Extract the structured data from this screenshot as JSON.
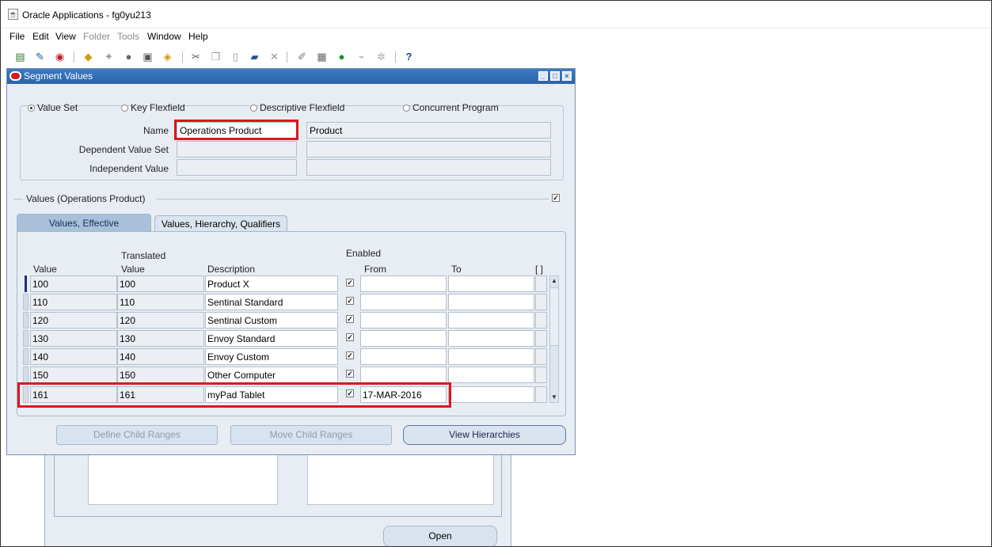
{
  "app": {
    "title": "Oracle Applications - fg0yu213"
  },
  "menu": [
    {
      "label": "File",
      "enabled": true
    },
    {
      "label": "Edit",
      "enabled": true
    },
    {
      "label": "View",
      "enabled": true
    },
    {
      "label": "Folder",
      "enabled": false
    },
    {
      "label": "Tools",
      "enabled": false
    },
    {
      "label": "Window",
      "enabled": true
    },
    {
      "label": "Help",
      "enabled": true
    }
  ],
  "toolbar_icons": [
    "new-icon",
    "find-icon",
    "navigator-icon",
    "save-icon",
    "next-step-icon",
    "switch-responsibility-icon",
    "print-icon",
    "close-form-icon",
    "cut-icon",
    "copy-icon",
    "paste-icon",
    "new-record-icon",
    "delete-record-icon",
    "edit-field-icon",
    "zoom-icon",
    "translations-icon",
    "attachments-icon",
    "folder-tools-icon",
    "help-icon"
  ],
  "window": {
    "title": "Segment Values"
  },
  "query_by": {
    "options": [
      "Value Set",
      "Key Flexfield",
      "Descriptive Flexfield",
      "Concurrent Program"
    ],
    "selected": "Value Set"
  },
  "fields": {
    "name_label": "Name",
    "name_value": "Operations Product",
    "name_desc": "Product",
    "dependent_label": "Dependent Value Set",
    "independent_label": "Independent Value"
  },
  "values_section": {
    "title": "Values (Operations Product)"
  },
  "tabs": [
    {
      "label": "Values, Effective",
      "active": true
    },
    {
      "label": "Values, Hierarchy, Qualifiers",
      "active": false
    }
  ],
  "columns": {
    "value": "Value",
    "translated_line1": "Translated",
    "translated_line2": "Value",
    "description": "Description",
    "enabled": "Enabled",
    "from": "From",
    "to": "To",
    "flex": "[ ]"
  },
  "rows": [
    {
      "value": "100",
      "translated": "100",
      "description": "Product X",
      "enabled": true,
      "from": "",
      "to": ""
    },
    {
      "value": "110",
      "translated": "110",
      "description": "Sentinal Standard",
      "enabled": true,
      "from": "",
      "to": ""
    },
    {
      "value": "120",
      "translated": "120",
      "description": "Sentinal Custom",
      "enabled": true,
      "from": "",
      "to": ""
    },
    {
      "value": "130",
      "translated": "130",
      "description": "Envoy Standard",
      "enabled": true,
      "from": "",
      "to": ""
    },
    {
      "value": "140",
      "translated": "140",
      "description": "Envoy Custom",
      "enabled": true,
      "from": "",
      "to": ""
    },
    {
      "value": "150",
      "translated": "150",
      "description": "Other Computer",
      "enabled": true,
      "from": "",
      "to": ""
    },
    {
      "value": "161",
      "translated": "161",
      "description": "myPad Tablet",
      "enabled": true,
      "from": "17-MAR-2016",
      "to": ""
    }
  ],
  "buttons": {
    "define_child_ranges": "Define Child Ranges",
    "move_child_ranges": "Move Child Ranges",
    "view_hierarchies": "View Hierarchies",
    "open": "Open"
  },
  "colors": {
    "highlight": "#e0141c",
    "title_bar": "#2a63a8",
    "form_bg": "#e8edf3"
  }
}
